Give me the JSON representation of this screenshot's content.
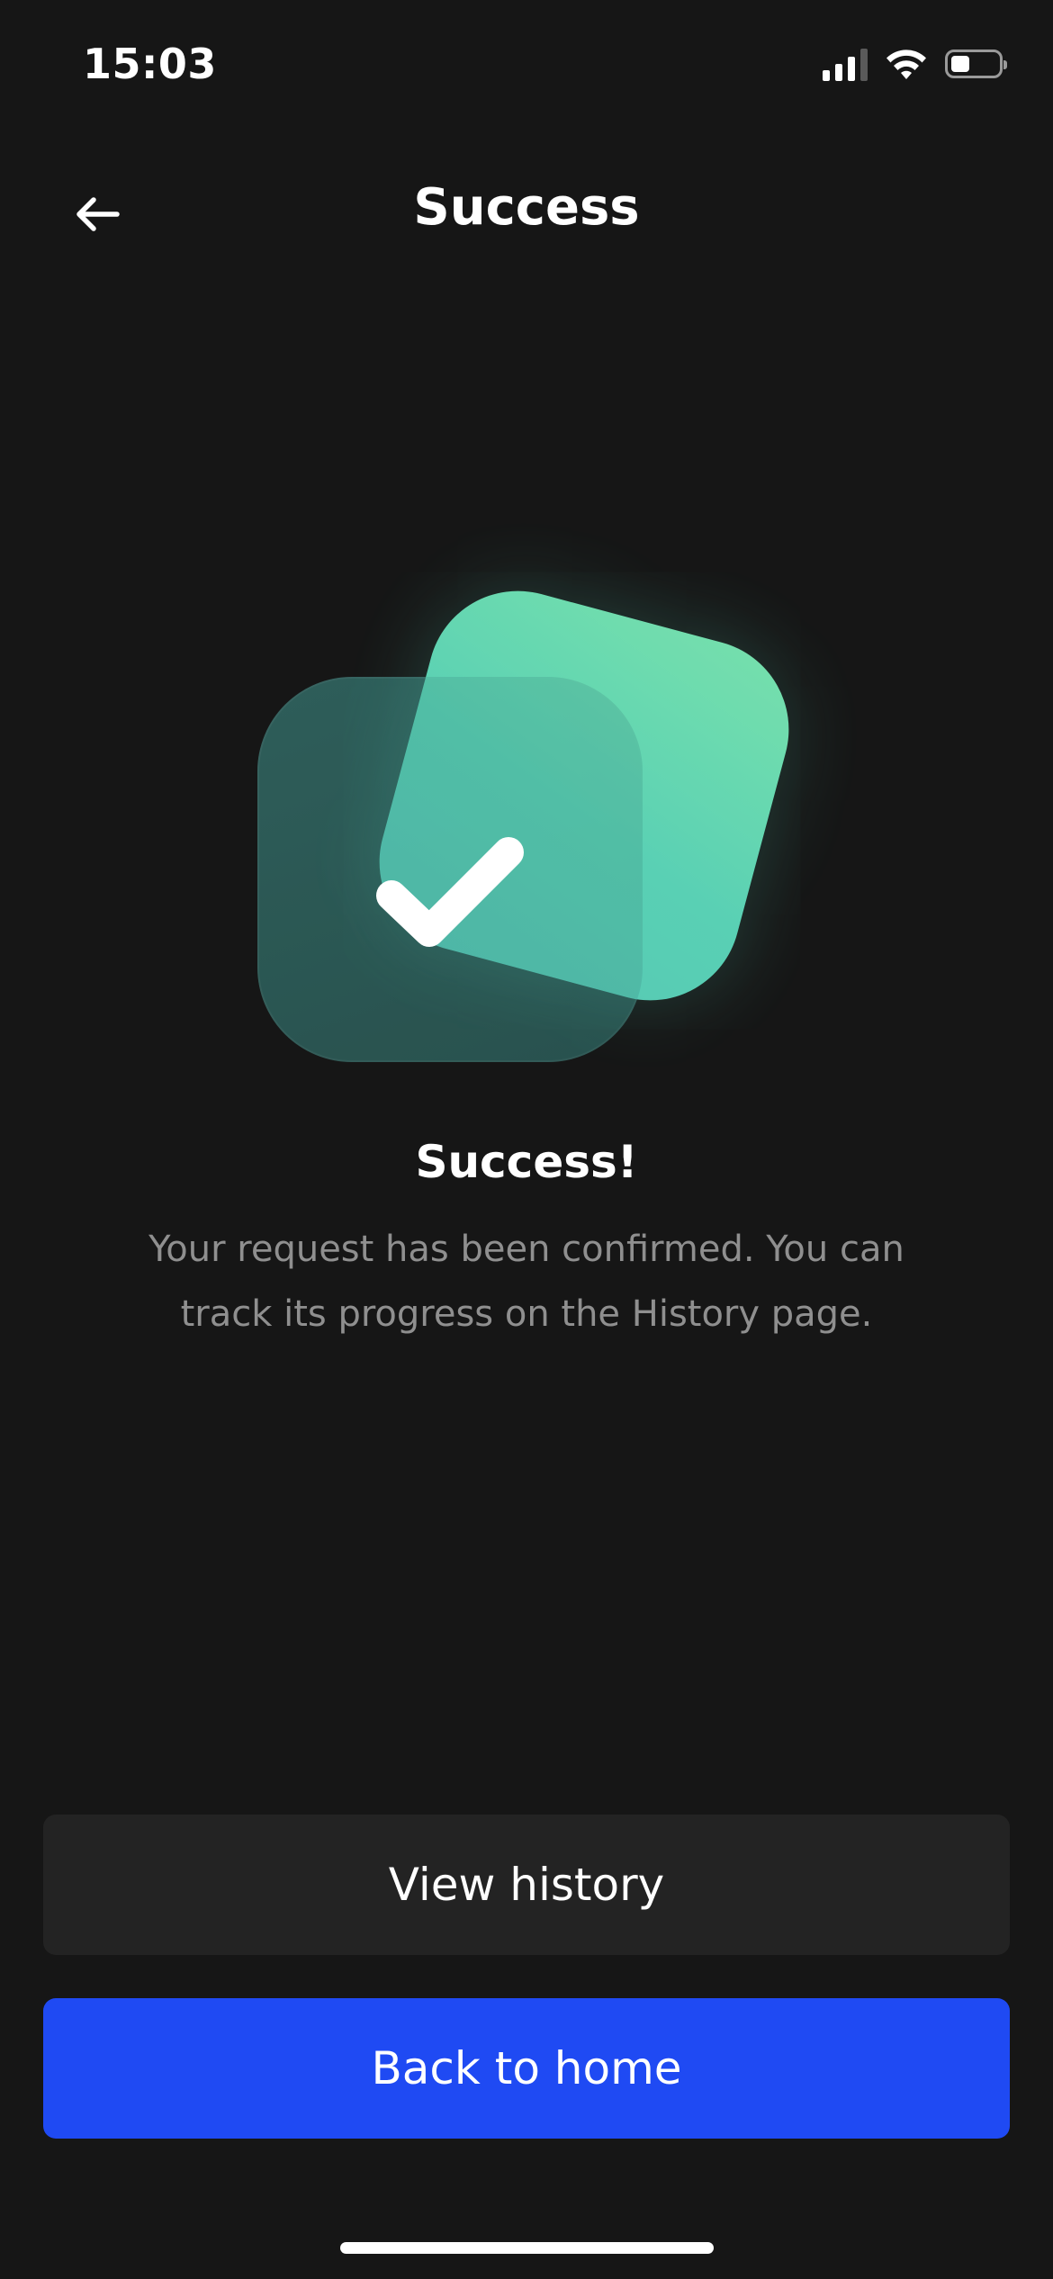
{
  "status_bar": {
    "time": "15:03",
    "icons": [
      "signal-icon",
      "wifi-icon",
      "battery-icon"
    ]
  },
  "header": {
    "back_icon": "arrow-left-icon",
    "title": "Success"
  },
  "illustration": {
    "icon": "check-icon",
    "colors": {
      "front_card": "#6fe6bd",
      "back_card": "#2b524f",
      "check": "#ffffff"
    }
  },
  "message": {
    "title": "Success!",
    "body": "Your request has been confirmed. You can track its progress on the History page."
  },
  "actions": {
    "view_history_label": "View history",
    "back_home_label": "Back to home"
  },
  "colors": {
    "background": "#161616",
    "primary_button": "#1f4af3",
    "secondary_button": "#232323",
    "body_text": "#8f8f8f"
  }
}
